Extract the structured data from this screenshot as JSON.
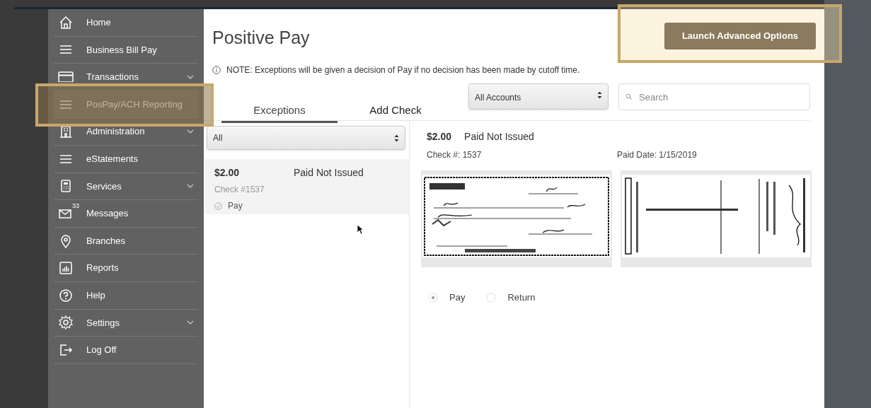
{
  "sidebar": {
    "items": [
      {
        "label": "Home",
        "selected": false,
        "expandable": false
      },
      {
        "label": "Business Bill Pay",
        "selected": false,
        "expandable": false
      },
      {
        "label": "Transactions",
        "selected": false,
        "expandable": true
      },
      {
        "label": "PosPay/ACH Reporting",
        "selected": true,
        "expandable": false
      },
      {
        "label": "Administration",
        "selected": false,
        "expandable": true
      },
      {
        "label": "eStatements",
        "selected": false,
        "expandable": false
      },
      {
        "label": "Services",
        "selected": false,
        "expandable": true
      },
      {
        "label": "Messages",
        "selected": false,
        "expandable": false,
        "badge": "33"
      },
      {
        "label": "Branches",
        "selected": false,
        "expandable": false
      },
      {
        "label": "Reports",
        "selected": false,
        "expandable": false
      },
      {
        "label": "Help",
        "selected": false,
        "expandable": false
      },
      {
        "label": "Settings",
        "selected": false,
        "expandable": true
      },
      {
        "label": "Log Off",
        "selected": false,
        "expandable": false
      }
    ]
  },
  "page": {
    "title": "Positive Pay",
    "launch_button": "Launch Advanced Options",
    "note": "NOTE: Exceptions will be given a decision of Pay if no decision has been made by cutoff time."
  },
  "tabs": [
    {
      "label": "Exceptions",
      "selected": true
    },
    {
      "label": "Add Check",
      "selected": false
    }
  ],
  "account_select": {
    "value": "All Accounts"
  },
  "search": {
    "placeholder": "Search"
  },
  "filter_select": {
    "value": "All"
  },
  "exceptions": [
    {
      "amount": "$2.00",
      "type": "Paid Not Issued",
      "check": "Check #1537",
      "decision": "Pay",
      "selected": true
    }
  ],
  "detail": {
    "amount": "$2.00",
    "type": "Paid Not Issued",
    "check": "Check #: 1537",
    "paid_date": "Paid Date: 1/15/2019",
    "decisions": [
      {
        "label": "Pay",
        "selected": true
      },
      {
        "label": "Return",
        "selected": false
      }
    ]
  }
}
